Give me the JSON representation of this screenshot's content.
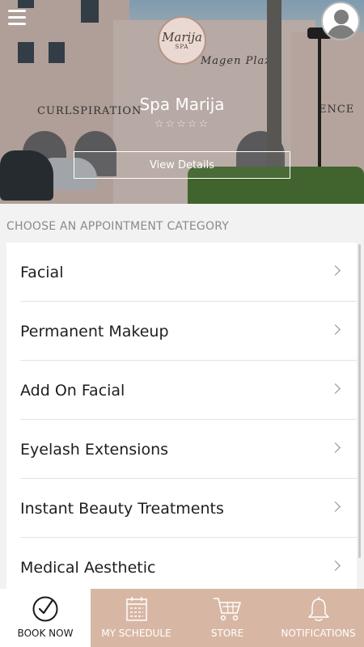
{
  "header": {
    "spa_name": "Spa Marija",
    "logo_text": "Marija",
    "logo_subtext": "SPA",
    "rating_stars": "☆☆☆☆☆",
    "view_details_label": "View Details",
    "storefront_signs": [
      "CURLSPIRATION",
      "Magen Plaza",
      "ENCE"
    ]
  },
  "section_title": "CHOOSE AN APPOINTMENT CATEGORY",
  "categories": [
    {
      "label": "Facial"
    },
    {
      "label": "Permanent Makeup"
    },
    {
      "label": "Add On Facial"
    },
    {
      "label": "Eyelash Extensions"
    },
    {
      "label": "Instant Beauty Treatments"
    },
    {
      "label": "Medical Aesthetic"
    }
  ],
  "bottom_nav": [
    {
      "label": "BOOK NOW",
      "icon": "check-circle-icon",
      "active": true
    },
    {
      "label": "MY SCHEDULE",
      "icon": "calendar-icon",
      "active": false
    },
    {
      "label": "STORE",
      "icon": "cart-icon",
      "active": false
    },
    {
      "label": "NOTIFICATIONS",
      "icon": "bell-icon",
      "active": false
    }
  ],
  "colors": {
    "accent": "#d7b7a4",
    "list_background": "#ffffff",
    "page_background": "#f2f2f2"
  }
}
